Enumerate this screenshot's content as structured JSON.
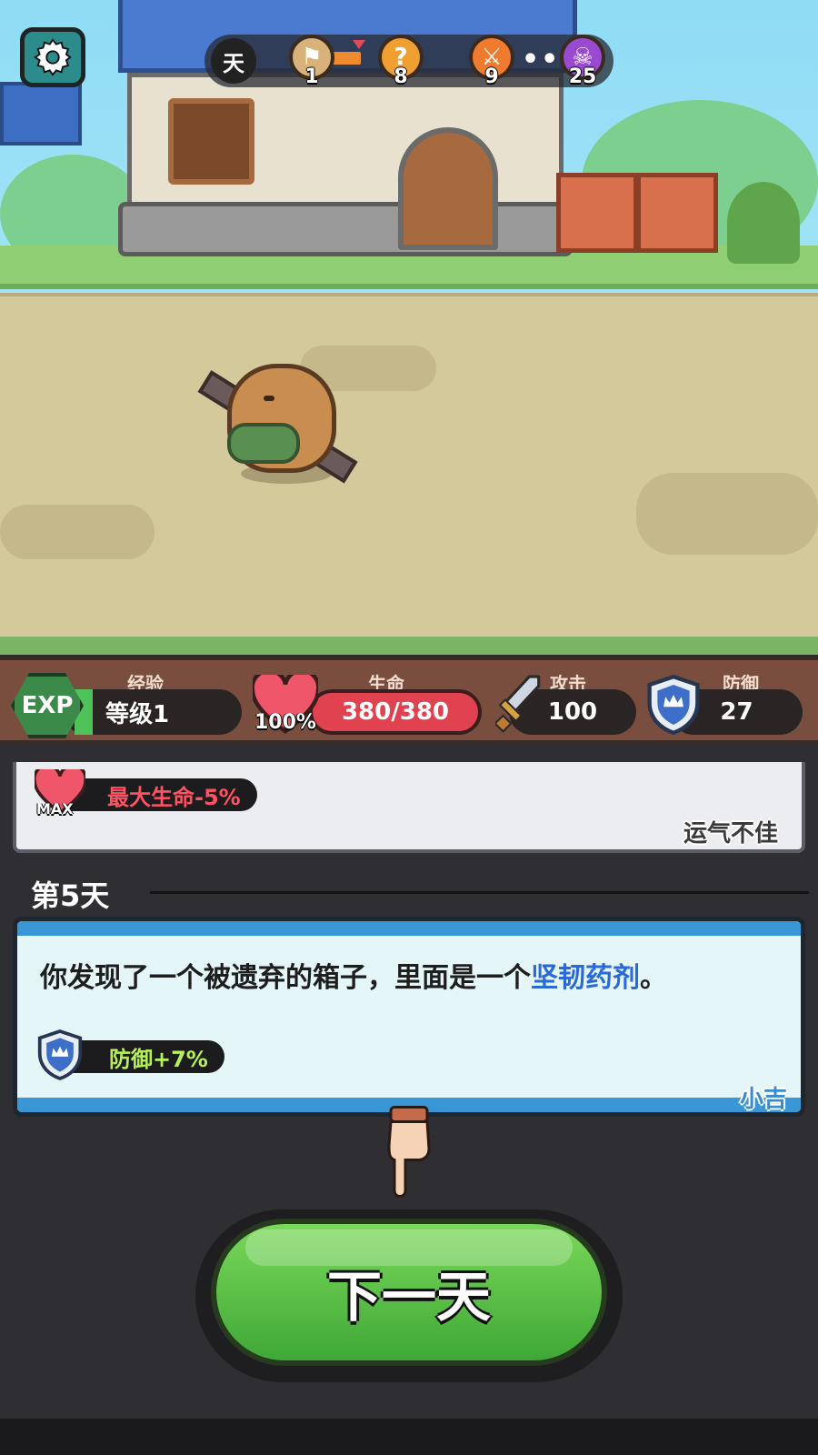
{
  "hud": {
    "day_label": "天",
    "nodes": [
      {
        "icon": "flag-icon",
        "value": "1",
        "color": "#d9b27a"
      },
      {
        "icon": "question-icon",
        "value": "8",
        "color": "#f0a030"
      },
      {
        "icon": "crossed-swords-icon",
        "value": "9",
        "color": "#f07a2e"
      },
      {
        "icon": "skull-icon",
        "value": "25",
        "color": "#9a4ad0"
      }
    ],
    "dots": "•••"
  },
  "stats": {
    "exp": {
      "caption": "经验",
      "badge": "EXP",
      "level": "等级1"
    },
    "hp": {
      "caption": "生命",
      "value": "380/380",
      "percent": "100%"
    },
    "attack": {
      "caption": "攻击",
      "value": "100"
    },
    "defense": {
      "caption": "防御",
      "value": "27"
    }
  },
  "previous_event": {
    "max_badge": "MAX",
    "effect": "最大生命-5%",
    "mood": "运气不佳"
  },
  "current_event": {
    "day_title": "第5天",
    "text_before": "你发现了一个被遗弃的箱子，里面是一个",
    "highlight": "坚韧药剂",
    "text_after": "。",
    "effect": "防御+7%",
    "mood": "小吉"
  },
  "next_button": "下一天",
  "colors": {
    "hp": "#e0434f",
    "button": "#4fc040",
    "highlight": "#2a6ad8",
    "negative": "#ff5262",
    "positive": "#b8f05a"
  }
}
